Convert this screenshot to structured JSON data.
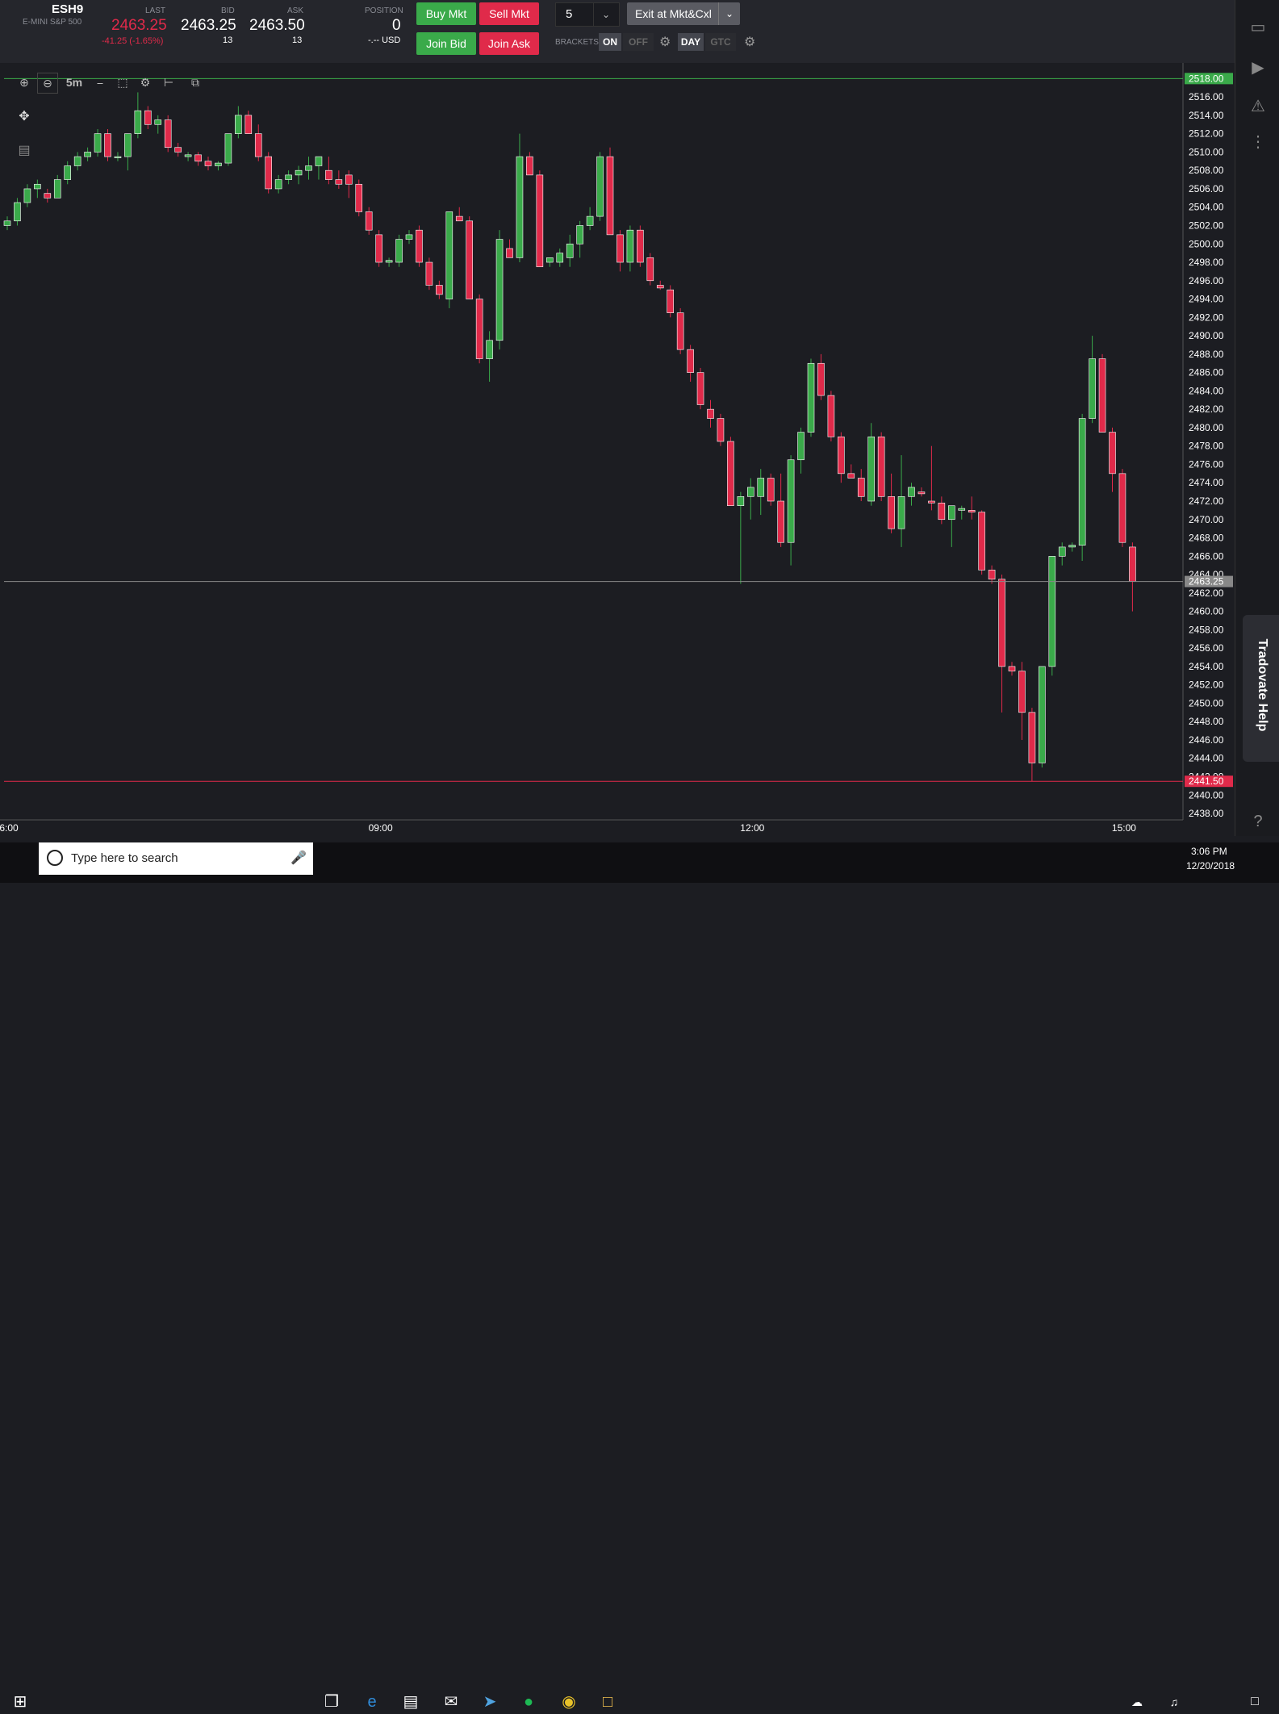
{
  "instrument": {
    "symbol": "ESH9",
    "name": "E-MINI S&P 500"
  },
  "quote": {
    "last_label": "LAST",
    "last": "2463.25",
    "change": "-41.25 (-1.65%)",
    "bid_label": "BID",
    "bid": "2463.25",
    "bid_size": "13",
    "ask_label": "ASK",
    "ask": "2463.50",
    "ask_size": "13"
  },
  "position": {
    "label": "POSITION",
    "value": "0",
    "pnl": "-.-- USD"
  },
  "order_buttons": {
    "buy_mkt": "Buy Mkt",
    "sell_mkt": "Sell Mkt",
    "join_bid": "Join Bid",
    "join_ask": "Join Ask"
  },
  "quantity": {
    "value": "5"
  },
  "exit_button": "Exit at Mkt&Cxl",
  "brackets": {
    "label": "BRACKETS",
    "on": "ON",
    "off": "OFF",
    "day": "DAY",
    "gtc": "GTC"
  },
  "chart_toolbar": {
    "timeframe": "5m"
  },
  "colors": {
    "up": "#3aaa4a",
    "down": "#e02a4a",
    "background": "#1c1d22",
    "axis_text": "#ffffff",
    "grid_line": "#3a3b40"
  },
  "chart_data": {
    "type": "candlestick",
    "x_ticks": [
      "6:00",
      "09:00",
      "12:00",
      "15:00"
    ],
    "y_ticks": [
      "2516.00",
      "2514.00",
      "2512.00",
      "2510.00",
      "2508.00",
      "2506.00",
      "2504.00",
      "2502.00",
      "2500.00",
      "2498.00",
      "2496.00",
      "2494.00",
      "2492.00",
      "2490.00",
      "2488.00",
      "2486.00",
      "2484.00",
      "2482.00",
      "2480.00",
      "2478.00",
      "2476.00",
      "2474.00",
      "2472.00",
      "2470.00",
      "2468.00",
      "2466.00",
      "2464.00",
      "2462.00",
      "2460.00",
      "2458.00",
      "2456.00",
      "2454.00",
      "2452.00",
      "2450.00",
      "2448.00",
      "2446.00",
      "2444.00",
      "2442.00",
      "2440.00",
      "2438.00"
    ],
    "ylim": [
      2437.3,
      2519.7
    ],
    "high_marker": "2518.00",
    "last_marker": "2463.25",
    "low_marker": "2441.50",
    "candles": [
      [
        2502,
        2503,
        2501.5,
        2502.5
      ],
      [
        2502.5,
        2505,
        2502,
        2504.5
      ],
      [
        2504.5,
        2506.5,
        2504,
        2506
      ],
      [
        2506,
        2507,
        2505,
        2506.5
      ],
      [
        2505.5,
        2506,
        2504.5,
        2505
      ],
      [
        2505,
        2507.5,
        2505,
        2507
      ],
      [
        2507,
        2509,
        2506.5,
        2508.5
      ],
      [
        2508.5,
        2510,
        2508,
        2509.5
      ],
      [
        2509.5,
        2510.5,
        2509,
        2510
      ],
      [
        2510,
        2512.5,
        2509.5,
        2512
      ],
      [
        2512,
        2512.5,
        2509,
        2509.5
      ],
      [
        2509.5,
        2510,
        2509,
        2509.5
      ],
      [
        2509.5,
        2512,
        2508,
        2512
      ],
      [
        2512,
        2516.5,
        2511.5,
        2514.5
      ],
      [
        2514.5,
        2515,
        2512.5,
        2513
      ],
      [
        2513,
        2514,
        2512,
        2513.5
      ],
      [
        2513.5,
        2514,
        2510,
        2510.5
      ],
      [
        2510.5,
        2511,
        2509.5,
        2510
      ],
      [
        2509.5,
        2510,
        2509,
        2509.7
      ],
      [
        2509.7,
        2510,
        2508.5,
        2509
      ],
      [
        2509,
        2509.5,
        2508,
        2508.5
      ],
      [
        2508.5,
        2509,
        2508,
        2508.8
      ],
      [
        2508.8,
        2512,
        2508.5,
        2512
      ],
      [
        2512,
        2515,
        2511.5,
        2514
      ],
      [
        2514,
        2514.5,
        2512,
        2512
      ],
      [
        2512,
        2513,
        2509,
        2509.5
      ],
      [
        2509.5,
        2510,
        2505.5,
        2506
      ],
      [
        2506,
        2507.5,
        2505.5,
        2507
      ],
      [
        2507,
        2508,
        2506.5,
        2507.5
      ],
      [
        2507.5,
        2508.5,
        2506.5,
        2508
      ],
      [
        2508,
        2509.5,
        2507,
        2508.5
      ],
      [
        2508.5,
        2509,
        2507,
        2509.5
      ],
      [
        2508,
        2509.5,
        2506.5,
        2507
      ],
      [
        2507,
        2508,
        2506,
        2506.5
      ],
      [
        2507.5,
        2508,
        2505,
        2506.5
      ],
      [
        2506.5,
        2507,
        2503,
        2503.5
      ],
      [
        2503.5,
        2504,
        2501,
        2501.5
      ],
      [
        2501,
        2501.5,
        2497.5,
        2498
      ],
      [
        2498,
        2498.5,
        2497.5,
        2498.2
      ],
      [
        2498,
        2501,
        2497.5,
        2500.5
      ],
      [
        2500.5,
        2501.5,
        2500,
        2501
      ],
      [
        2501.5,
        2502,
        2497.5,
        2498
      ],
      [
        2498,
        2498.5,
        2495,
        2495.5
      ],
      [
        2495.5,
        2496,
        2494,
        2494.5
      ],
      [
        2494,
        2503.5,
        2493,
        2503.5
      ],
      [
        2503,
        2504,
        2502.5,
        2502.5
      ],
      [
        2502.5,
        2503,
        2494,
        2494
      ],
      [
        2494,
        2494.5,
        2487,
        2487.5
      ],
      [
        2487.5,
        2490.5,
        2485,
        2489.5
      ],
      [
        2489.5,
        2501.5,
        2488.5,
        2500.5
      ],
      [
        2499.5,
        2500.5,
        2498.5,
        2498.5
      ],
      [
        2498.5,
        2512,
        2498,
        2509.5
      ],
      [
        2509.5,
        2510,
        2507.5,
        2507.5
      ],
      [
        2507.5,
        2508,
        2497.5,
        2497.5
      ],
      [
        2498,
        2498.5,
        2497.5,
        2498.5
      ],
      [
        2498,
        2499.5,
        2497.5,
        2499
      ],
      [
        2498.5,
        2501,
        2497.5,
        2500
      ],
      [
        2500,
        2502.5,
        2498.5,
        2502
      ],
      [
        2502,
        2504,
        2501.5,
        2503
      ],
      [
        2503,
        2510,
        2502.5,
        2509.5
      ],
      [
        2509.5,
        2510.5,
        2501,
        2501
      ],
      [
        2501,
        2501.5,
        2497,
        2498
      ],
      [
        2498,
        2502,
        2497,
        2501.5
      ],
      [
        2501.5,
        2502,
        2497.5,
        2498
      ],
      [
        2498.5,
        2499,
        2495.5,
        2496
      ],
      [
        2495.5,
        2496,
        2495,
        2495.2
      ],
      [
        2495,
        2495.5,
        2492,
        2492.5
      ],
      [
        2492.5,
        2493,
        2488,
        2488.5
      ],
      [
        2488.5,
        2489,
        2485,
        2486
      ],
      [
        2486,
        2486.5,
        2482,
        2482.5
      ],
      [
        2482,
        2483,
        2480,
        2481
      ],
      [
        2481,
        2481.5,
        2478,
        2478.5
      ],
      [
        2478.5,
        2479,
        2471.5,
        2471.5
      ],
      [
        2471.5,
        2473,
        2463,
        2472.5
      ],
      [
        2472.5,
        2474.5,
        2470,
        2473.5
      ],
      [
        2472.5,
        2475.5,
        2470.5,
        2474.5
      ],
      [
        2474.5,
        2475,
        2471.5,
        2472
      ],
      [
        2472,
        2475,
        2467,
        2467.5
      ],
      [
        2467.5,
        2477,
        2465,
        2476.5
      ],
      [
        2476.5,
        2480,
        2475,
        2479.5
      ],
      [
        2479.5,
        2487.5,
        2479,
        2487
      ],
      [
        2487,
        2488,
        2483,
        2483.5
      ],
      [
        2483.5,
        2484,
        2478.5,
        2479
      ],
      [
        2479,
        2479.5,
        2474,
        2475
      ],
      [
        2475,
        2476,
        2474.5,
        2474.5
      ],
      [
        2474.5,
        2475.5,
        2472,
        2472.5
      ],
      [
        2472,
        2480.5,
        2471.5,
        2479
      ],
      [
        2479,
        2479.5,
        2472,
        2472.5
      ],
      [
        2472.5,
        2475,
        2468.5,
        2469
      ],
      [
        2469,
        2477,
        2467,
        2472.5
      ],
      [
        2472.5,
        2474,
        2471.5,
        2473.5
      ],
      [
        2473,
        2473.5,
        2472.5,
        2472.8
      ],
      [
        2472,
        2478,
        2471,
        2471.8
      ],
      [
        2471.8,
        2472.5,
        2469.5,
        2470
      ],
      [
        2470,
        2471,
        2467,
        2471.5
      ],
      [
        2471,
        2471.5,
        2470,
        2471.2
      ],
      [
        2471,
        2472.5,
        2470,
        2470.8
      ],
      [
        2470.8,
        2471,
        2464,
        2464.5
      ],
      [
        2464.5,
        2465,
        2463,
        2463.5
      ],
      [
        2463.5,
        2464,
        2449,
        2454
      ],
      [
        2454,
        2454.5,
        2453,
        2453.5
      ],
      [
        2453.5,
        2454.5,
        2446,
        2449
      ],
      [
        2449,
        2449.5,
        2441.5,
        2443.5
      ],
      [
        2443.5,
        2454,
        2443,
        2454
      ],
      [
        2454,
        2466,
        2453,
        2466
      ],
      [
        2466,
        2467.5,
        2465,
        2467
      ],
      [
        2467,
        2467.5,
        2466.5,
        2467.2
      ],
      [
        2467.2,
        2481.5,
        2465.5,
        2481
      ],
      [
        2481,
        2490,
        2480.5,
        2487.5
      ],
      [
        2487.5,
        2488,
        2479.5,
        2479.5
      ],
      [
        2479.5,
        2480,
        2473,
        2475
      ],
      [
        2475,
        2475.5,
        2467,
        2467.5
      ],
      [
        2467,
        2467.5,
        2460,
        2463.25
      ]
    ]
  },
  "taskbar": {
    "search_placeholder": "Type here to search",
    "time": "3:06 PM",
    "date": "12/20/2018"
  },
  "help_tab": "Tradovate Help"
}
